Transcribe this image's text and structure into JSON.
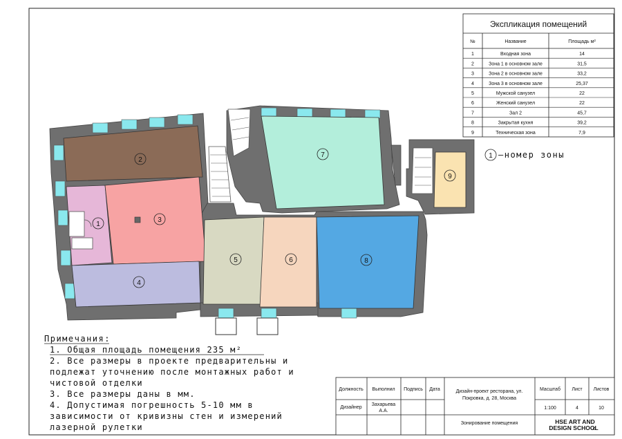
{
  "explication": {
    "title": "Экспликация помещений",
    "headers": [
      "№",
      "Название",
      "Площадь м²"
    ],
    "rows": [
      [
        "1",
        "Входная зона",
        "14"
      ],
      [
        "2",
        "Зона 1 в основном зале",
        "31,5"
      ],
      [
        "3",
        "Зона 2 в основном зале",
        "33,2"
      ],
      [
        "4",
        "Зона 3 в основном зале",
        "25,37"
      ],
      [
        "5",
        "Мужской санузел",
        "22"
      ],
      [
        "6",
        "Женский санузел",
        "22"
      ],
      [
        "7",
        "Зал 2",
        "45,7"
      ],
      [
        "8",
        "Закрытая кухня",
        "39,2"
      ],
      [
        "9",
        "Техническая зона",
        "7,9"
      ]
    ]
  },
  "legend": {
    "marker": "1",
    "text": "–номер зоны"
  },
  "zones": [
    {
      "num": "1",
      "color": "#e6b7d8"
    },
    {
      "num": "2",
      "color": "#8b6b57"
    },
    {
      "num": "3",
      "color": "#f7a3a3"
    },
    {
      "num": "4",
      "color": "#bcbcdf"
    },
    {
      "num": "5",
      "color": "#d8d9c2"
    },
    {
      "num": "6",
      "color": "#f6d6be"
    },
    {
      "num": "7",
      "color": "#b3eedb"
    },
    {
      "num": "8",
      "color": "#54a8e3"
    },
    {
      "num": "9",
      "color": "#fae3b1"
    }
  ],
  "colors": {
    "wall": "#6f6f6f",
    "window": "#8ae8ee"
  },
  "notes": {
    "title": "Примечания:",
    "lines": [
      "1. Общая площадь помещения 235 м²",
      "2. Все размеры в проекте предварительны и",
      "   подлежат уточнению после монтажных работ и",
      "   чистовой отделки",
      "3. Все размеры даны в мм.",
      "4. Допустимая погрешность 5-10 мм в",
      "   зависимости от кривизны стен и измерений",
      "   лазерной рулетки"
    ]
  },
  "stamp": {
    "col_position": "Должность",
    "col_executed": "Выполнил",
    "col_sign": "Подпись",
    "col_date": "Дата",
    "position": "Дизайнер",
    "executor_line1": "Захарьева",
    "executor_line2": "А.А.",
    "project_line1": "Дизайн-проект ресторана, ул.",
    "project_line2": "Покровка, д. 28, Москва",
    "scale_label": "Масштаб",
    "sheet_label": "Лист",
    "sheets_label": "Листов",
    "scale": "1:100",
    "sheet": "4",
    "sheets": "10",
    "drawing_name": "Зонирование помещения",
    "logo_line1": "HSE ART AND",
    "logo_line2": "DESIGN SCHOOL"
  }
}
